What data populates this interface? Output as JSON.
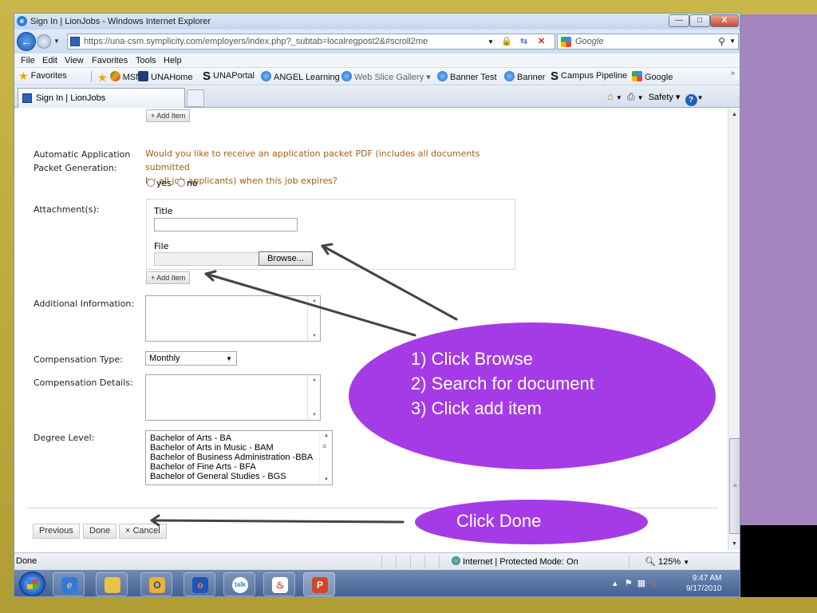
{
  "window": {
    "title": "Sign In | LionJobs - Windows Internet Explorer",
    "minimize": "—",
    "maximize": "□",
    "close": "X"
  },
  "address_bar": {
    "url": "https://una-csm.symplicity.com/employers/index.php?_subtab=localregpost2&#scroll2me",
    "search_placeholder": "Google"
  },
  "menu": [
    "File",
    "Edit",
    "View",
    "Favorites",
    "Tools",
    "Help"
  ],
  "favorites": {
    "label": "Favorites",
    "items": [
      "MSN",
      "UNAHome",
      "UNAPortal",
      "ANGEL Learning",
      "Web Slice Gallery ▾",
      "Banner Test",
      "Banner",
      "Campus Pipeline",
      "Google"
    ]
  },
  "tab": {
    "label": "Sign In | LionJobs",
    "safety": "Safety ▾"
  },
  "form": {
    "add_item_top": "+ Add Item",
    "auto_packet_label_1": "Automatic Application",
    "auto_packet_label_2": "Packet Generation:",
    "question_1": "Would you like to receive an application packet PDF (includes all documents submitted",
    "question_2": "by all job applicants) when this job expires?",
    "radio_yes": "yes",
    "radio_no": "no",
    "attachments_label": "Attachment(s):",
    "attach_title": "Title",
    "attach_file": "File",
    "browse": "Browse...",
    "add_item_attach": "+ Add Item",
    "additional_info_label": "Additional Information:",
    "comp_type_label": "Compensation Type:",
    "comp_type_value": "Monthly",
    "comp_details_label": "Compensation Details:",
    "degree_label": "Degree Level:",
    "degree_options": [
      "Bachelor of Arts - BA",
      "Bachelor of Arts in Music - BAM",
      "Bachelor of Business Administration -BBA",
      "Bachelor of Fine Arts - BFA",
      "Bachelor of General Studies - BGS"
    ],
    "previous": "Previous",
    "done": "Done",
    "cancel": "× Cancel"
  },
  "status": {
    "left": "Done",
    "zone": "Internet | Protected Mode: On",
    "zoom": "125%"
  },
  "taskbar": {
    "time": "9:47 AM",
    "date": "9/17/2010"
  },
  "callouts": {
    "step1": "1) Click Browse",
    "step2": "2) Search for  document",
    "step3": "3) Click add item",
    "done": "Click Done"
  },
  "colors": {
    "callout": "#a53be6",
    "question_text": "#a35f15",
    "slide_side": "#a585bf"
  }
}
